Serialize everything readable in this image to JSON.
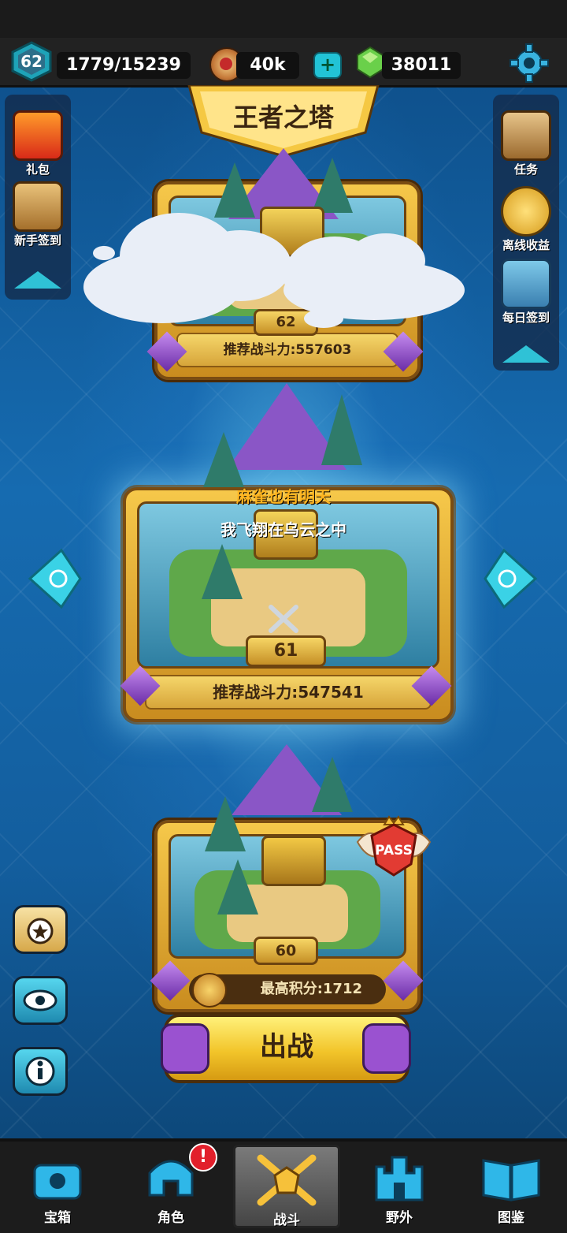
{
  "screen_title": "王者之塔",
  "player": {
    "level": "62",
    "exp": "1779/15239"
  },
  "currency": {
    "coins": "40k",
    "gems": "38011"
  },
  "side_left": [
    {
      "label": "礼包",
      "icon": "gift-box-icon"
    },
    {
      "label": "新手签到",
      "icon": "scroll-quill-icon"
    }
  ],
  "side_right": [
    {
      "label": "任务",
      "icon": "treasure-map-icon"
    },
    {
      "label": "离线收益",
      "icon": "gold-coin-stack-icon"
    },
    {
      "label": "每日签到",
      "icon": "checklist-icon"
    }
  ],
  "stages": {
    "upper": {
      "floor": "62",
      "recommend": "推荐战斗力:557603"
    },
    "current": {
      "floor": "61",
      "recommend": "推荐战斗力:547541"
    },
    "lower": {
      "floor": "60",
      "best_score": "最高积分:1712",
      "pass_label": "PASS"
    }
  },
  "chat": {
    "line1": "麻雀也有明天",
    "line2": "我飞翔在乌云之中"
  },
  "fight_button": "出战",
  "bottom_nav": [
    {
      "label": "宝箱",
      "icon": "treasure-chest-icon"
    },
    {
      "label": "角色",
      "icon": "helmet-icon",
      "badge": "!"
    },
    {
      "label": "战斗",
      "icon": "crossed-swords-icon",
      "active": true
    },
    {
      "label": "野外",
      "icon": "castle-icon"
    },
    {
      "label": "图鉴",
      "icon": "book-icon"
    }
  ],
  "colors": {
    "accent": "#2fc2d6",
    "gold": "#f2c52a",
    "purple": "#8a56c6"
  }
}
